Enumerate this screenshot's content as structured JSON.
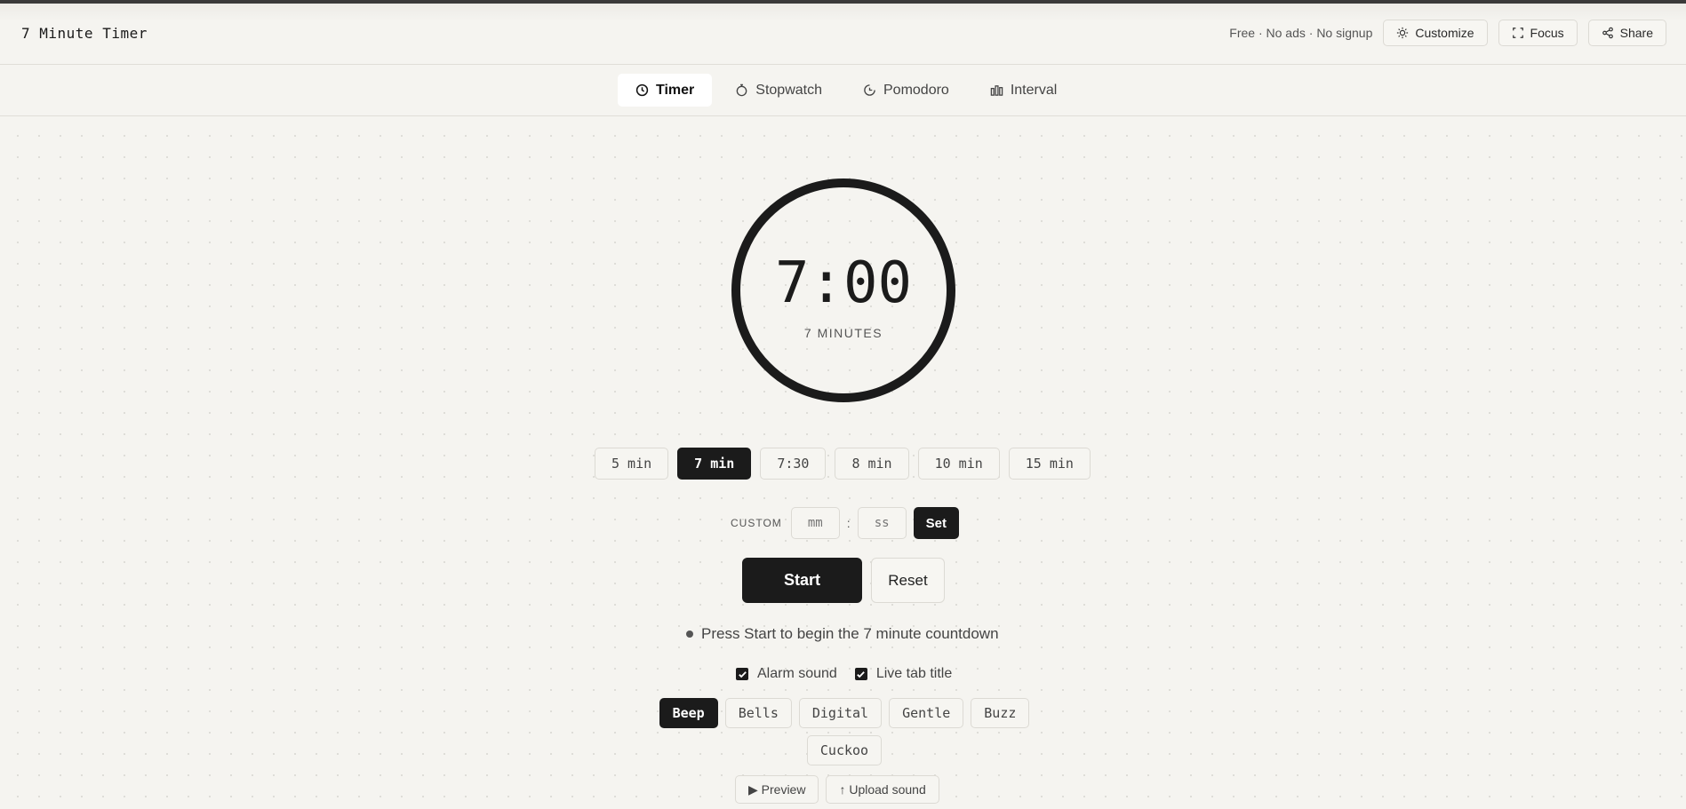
{
  "app": {
    "title": "7 Minute Timer",
    "tagline": "Free · No ads · No signup",
    "header_buttons": [
      {
        "label": "Customize",
        "icon": "sun-icon"
      },
      {
        "label": "Focus",
        "icon": "expand-icon"
      },
      {
        "label": "Share",
        "icon": "share-icon"
      }
    ]
  },
  "tabs": [
    {
      "label": "Timer",
      "icon": "clock-icon",
      "active": true
    },
    {
      "label": "Stopwatch",
      "icon": "stopwatch-icon",
      "active": false
    },
    {
      "label": "Pomodoro",
      "icon": "pomodoro-icon",
      "active": false
    },
    {
      "label": "Interval",
      "icon": "bars-icon",
      "active": false
    }
  ],
  "timer": {
    "display": "7:00",
    "subtitle": "7 MINUTES"
  },
  "presets": [
    {
      "label": "5 min",
      "active": false
    },
    {
      "label": "7 min",
      "active": true
    },
    {
      "label": "7:30",
      "active": false
    },
    {
      "label": "8 min",
      "active": false
    },
    {
      "label": "10 min",
      "active": false
    },
    {
      "label": "15 min",
      "active": false
    }
  ],
  "custom": {
    "label": "CUSTOM",
    "minutes_placeholder": "mm",
    "seconds_placeholder": "ss",
    "separator": ":",
    "set_label": "Set"
  },
  "actions": {
    "start_label": "Start",
    "reset_label": "Reset"
  },
  "status_text": "Press Start to begin the 7 minute countdown",
  "options": {
    "alarm_sound": {
      "label": "Alarm sound",
      "checked": true
    },
    "live_tab_title": {
      "label": "Live tab title",
      "checked": true
    }
  },
  "sounds": [
    {
      "label": "Beep",
      "active": true
    },
    {
      "label": "Bells",
      "active": false
    },
    {
      "label": "Digital",
      "active": false
    },
    {
      "label": "Gentle",
      "active": false
    },
    {
      "label": "Buzz",
      "active": false
    },
    {
      "label": "Cuckoo",
      "active": false
    }
  ],
  "extra": {
    "preview_label": "▶ Preview",
    "upload_label": "↑ Upload sound"
  },
  "colors": {
    "background": "#f5f4f0",
    "accent": "#1b1b1b"
  }
}
